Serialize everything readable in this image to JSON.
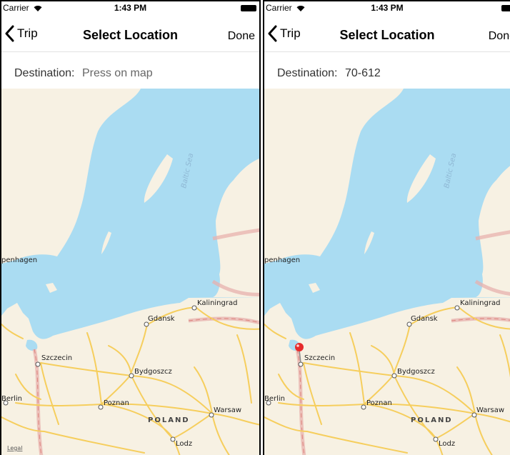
{
  "status_bar": {
    "carrier": "Carrier",
    "time": "1:43 PM"
  },
  "nav": {
    "back_label": "Trip",
    "title": "Select Location",
    "done_label": "Done"
  },
  "screens": {
    "left": {
      "destination_label": "Destination:",
      "destination_value": "Press on map"
    },
    "right": {
      "destination_label": "Destination:",
      "destination_value": "70-612"
    }
  },
  "map": {
    "sea_label": "Baltic Sea",
    "country_label": "POLAND",
    "legal": "Legal",
    "cities": {
      "copenhagen": "penhagen",
      "kaliningrad": "Kaliningrad",
      "gdansk": "Gdansk",
      "szczecin": "Szczecin",
      "bydgoszcz": "Bydgoszcz",
      "berlin": "Berlin",
      "poznan": "Poznan",
      "warsaw": "Warsaw",
      "lodz": "Lodz"
    }
  },
  "colors": {
    "water": "#aadcf2",
    "land": "#f7f1e3",
    "road": "#f6ce5d",
    "border": "#e8b1ae",
    "pin": "#e62b2b"
  }
}
